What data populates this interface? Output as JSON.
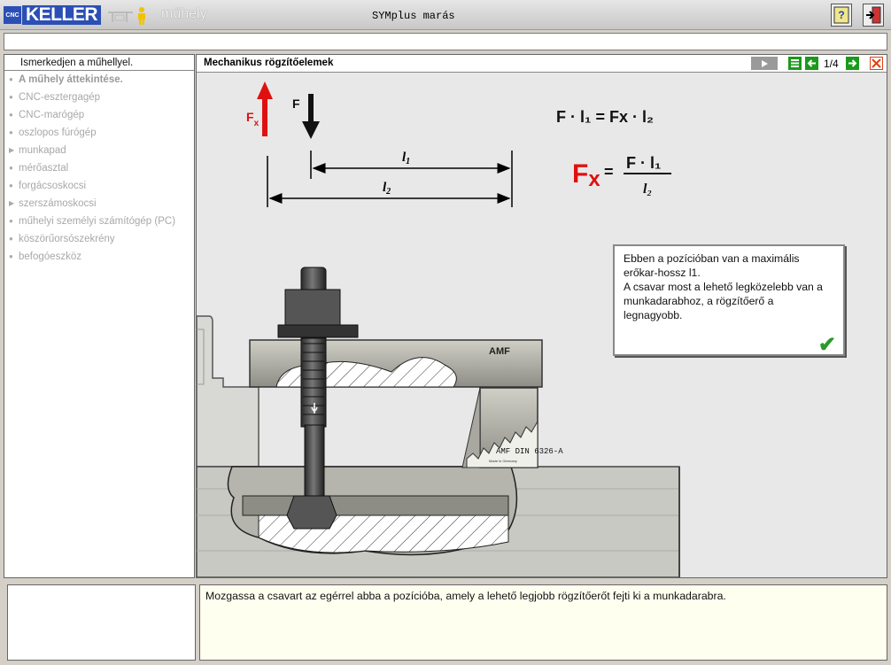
{
  "app": {
    "logo_prefix": "CNC",
    "logo_text": "KELLER",
    "section_label": "műhely",
    "title": "SYMplus marás"
  },
  "sidebar": {
    "header": "Ismerkedjen a műhellyel.",
    "items": [
      {
        "label": "A műhely áttekintése.",
        "marker": "●",
        "active": true
      },
      {
        "label": "CNC-esztergagép",
        "marker": "●"
      },
      {
        "label": "CNC-marógép",
        "marker": "●"
      },
      {
        "label": "oszlopos fúrógép",
        "marker": "●"
      },
      {
        "label": "munkapad",
        "marker": "▶"
      },
      {
        "label": "mérőasztal",
        "marker": "●"
      },
      {
        "label": "forgácsoskocsi",
        "marker": "●"
      },
      {
        "label": "szerszámoskocsi",
        "marker": "▶"
      },
      {
        "label": "műhelyi személyi számítógép (PC)",
        "marker": "●"
      },
      {
        "label": "köszörűorsószekrény",
        "marker": "●"
      },
      {
        "label": "befogóeszköz",
        "marker": "●"
      }
    ]
  },
  "main": {
    "title": "Mechanikus rögzítőelemek",
    "page": "1/4",
    "diagram": {
      "f": "F",
      "fx_main": "F",
      "fx_sub": "x",
      "l1_label": "l",
      "l1_sub": "1",
      "l2_label": "l",
      "l2_sub": "2",
      "eq1_left": "F · l₁",
      "eq1_eq": "=",
      "eq1_right": "Fx · l₂",
      "eq2_num": "F · l₁",
      "eq2_den": "l₂",
      "amf": "AMF",
      "din": "AMF  DIN 6326-A",
      "made_in": "Made in Germany"
    },
    "info_text": "Ebben a pozícióban van a maximális erőkar-hossz l1.\nA csavar most a lehető legközelebb van a munkadarabhoz, a rögzítőerő a legnagyobb."
  },
  "instruction": "Mozgassa a csavart az egérrel abba a pozícióba, amely a lehető legjobb rögzítőerőt fejti ki a munkadarabra.",
  "colors": {
    "red": "#e01010",
    "brand_blue": "#2b4fb5",
    "nav_green": "#1a9a1a"
  },
  "icons": [
    "workshop-icon",
    "help-icon",
    "exit-icon",
    "play-icon",
    "list-icon",
    "prev-icon",
    "next-icon",
    "close-icon",
    "check-icon"
  ]
}
